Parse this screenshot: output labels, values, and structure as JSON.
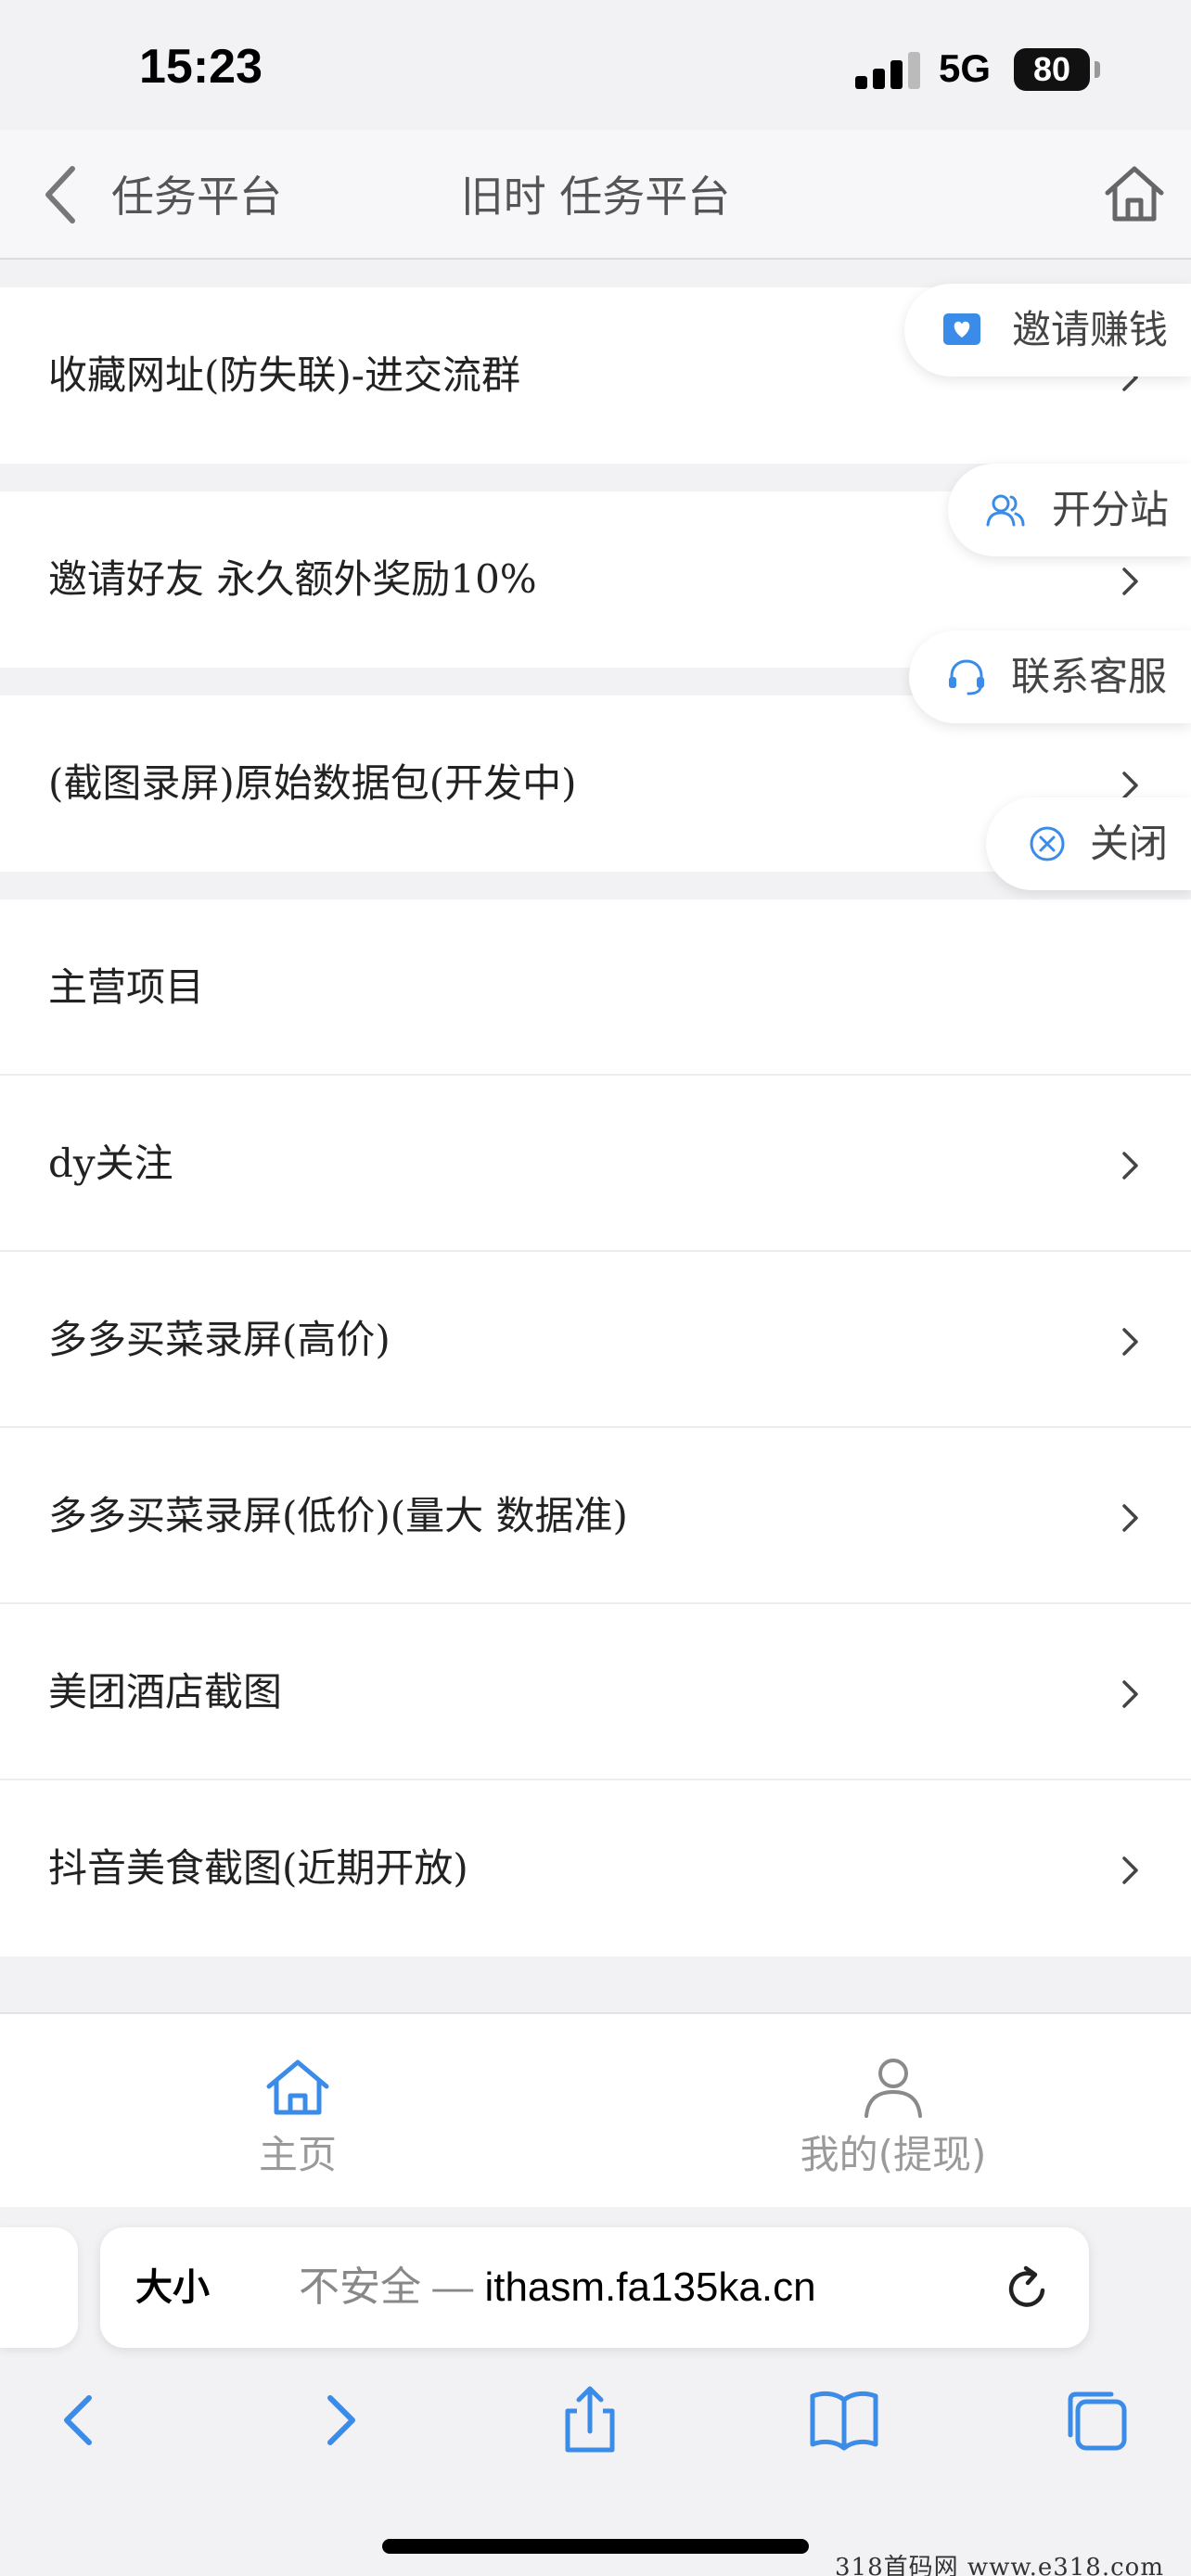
{
  "status_bar": {
    "time": "15:23",
    "network": "5G",
    "battery": "80"
  },
  "nav": {
    "back_label": "任务平台",
    "title": "旧时 任务平台"
  },
  "groups": [
    {
      "items": [
        {
          "label": "收藏网址(防失联)-进交流群",
          "chevron": true
        }
      ]
    },
    {
      "items": [
        {
          "label": "邀请好友 永久额外奖励10%",
          "chevron": true
        }
      ]
    },
    {
      "items": [
        {
          "label": "(截图录屏)原始数据包(开发中)",
          "chevron": true
        }
      ]
    },
    {
      "items": [
        {
          "label": "主营项目",
          "chevron": false
        },
        {
          "label": "dy关注",
          "chevron": true
        },
        {
          "label": "多多买菜录屏(高价)",
          "chevron": true
        },
        {
          "label": "多多买菜录屏(低价)(量大 数据准)",
          "chevron": true
        },
        {
          "label": "美团酒店截图",
          "chevron": true
        },
        {
          "label": "抖音美食截图(近期开放)",
          "chevron": true
        }
      ]
    }
  ],
  "floating_menu": {
    "invite": "邀请赚钱",
    "branch": "开分站",
    "support": "联系客服",
    "close": "关闭"
  },
  "tabbar": {
    "home": "主页",
    "mine": "我的(提现)"
  },
  "safari": {
    "text_size": "大小",
    "insecure": "不安全 — ",
    "domain": "ithasm.fa135ka.cn"
  },
  "watermark": "318首码网  www.e318.com",
  "colors": {
    "accent_blue": "#3b8ce8",
    "icon_gray": "#777777",
    "tab_inactive": "#9a9a9a"
  }
}
